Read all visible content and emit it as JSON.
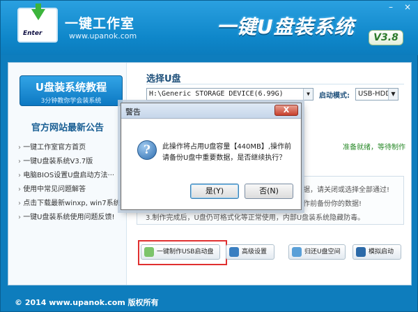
{
  "window": {
    "minimize": "–",
    "close": "×"
  },
  "header": {
    "logo_enter": "Enter",
    "brand": "一键工作室",
    "brand_url": "www.upanok.com",
    "product_title": "一键U盘装系统",
    "version": "V3.8"
  },
  "sidebar": {
    "tutorial_title": "U盘装系统教程",
    "tutorial_sub": "3分钟教你学会装系统",
    "news_title": "官方网站最新公告",
    "news": [
      "一键工作室官方首页",
      "一键U盘装系统V3.7版",
      "电脑BIOS设置U盘启动方法···",
      "使用中常见问题解答",
      "点击下载最新winxp, win7系统",
      "一键U盘装系统使用问题反馈!"
    ]
  },
  "select_disk": {
    "label": "选择U盘",
    "disk_value": "H:\\Generic STORAGE DEVICE(6.99G)",
    "mode_label": "启动模式:",
    "mode_value": "USB-HDD"
  },
  "status": "准备就绪，等待制作",
  "info": [
    "据，请关闭或选择全部通过!",
    "作前备份你的数据!",
    "3.制作完成后，U盘仍可格式化等正常使用，内部U盘装系统隐藏防毒。"
  ],
  "actions": {
    "make_usb": "一键制作USB启动盘",
    "advanced": "高级设置",
    "restore": "归还U盘空间",
    "simulate": "模拟启动"
  },
  "footer": "© 2014 www.upanok.com   版权所有",
  "dialog": {
    "title": "警告",
    "close": "X",
    "line1": "此操作将占用U盘容量【440MB】,操作前",
    "line2": "请备份U盘中重要数据，是否继续执行？",
    "yes": "是(Y)",
    "no": "否(N)"
  },
  "colors": {
    "accent_blue": "#0e7dbd",
    "status_green": "#2a8a2a",
    "highlight_red": "#e03030"
  }
}
